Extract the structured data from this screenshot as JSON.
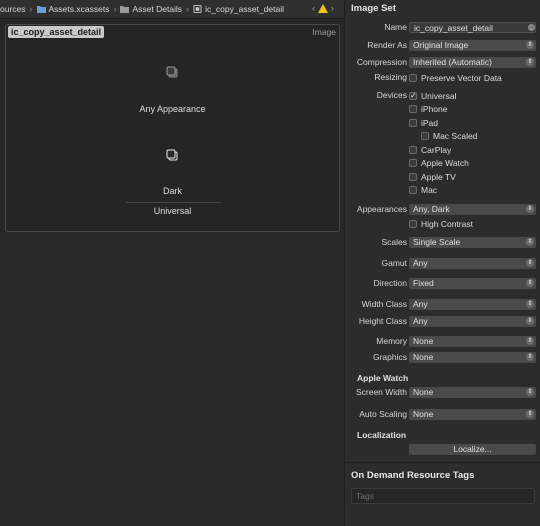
{
  "breadcrumb": {
    "items": [
      "ources",
      "Assets.xcassets",
      "Asset Details",
      "ic_copy_asset_detail"
    ]
  },
  "canvas": {
    "asset_name": "ic_copy_asset_detail",
    "asset_type": "Image",
    "slots": [
      {
        "label": "Any Appearance"
      },
      {
        "label": "Dark"
      }
    ],
    "group_label": "Universal"
  },
  "inspector": {
    "section_title": "Image Set",
    "name_label": "Name",
    "name_value": "ic_copy_asset_detail",
    "render_as_label": "Render As",
    "render_as_value": "Original Image",
    "compression_label": "Compression",
    "compression_value": "Inherited (Automatic)",
    "resizing_label": "Resizing",
    "preserve_vector_label": "Preserve Vector Data",
    "devices_label": "Devices",
    "devices": [
      {
        "label": "Universal",
        "checked": true
      },
      {
        "label": "iPhone",
        "checked": false
      },
      {
        "label": "iPad",
        "checked": false
      },
      {
        "label": "Mac Scaled",
        "checked": false
      },
      {
        "label": "CarPlay",
        "checked": false
      },
      {
        "label": "Apple Watch",
        "checked": false
      },
      {
        "label": "Apple TV",
        "checked": false
      },
      {
        "label": "Mac",
        "checked": false
      }
    ],
    "appearances_label": "Appearances",
    "appearances_value": "Any, Dark",
    "high_contrast_label": "High Contrast",
    "scales_label": "Scales",
    "scales_value": "Single Scale",
    "gamut_label": "Gamut",
    "gamut_value": "Any",
    "direction_label": "Direction",
    "direction_value": "Fixed",
    "width_class_label": "Width Class",
    "width_class_value": "Any",
    "height_class_label": "Height Class",
    "height_class_value": "Any",
    "memory_label": "Memory",
    "memory_value": "None",
    "graphics_label": "Graphics",
    "graphics_value": "None",
    "apple_watch_title": "Apple Watch",
    "screen_width_label": "Screen Width",
    "screen_width_value": "None",
    "auto_scaling_label": "Auto Scaling",
    "auto_scaling_value": "None",
    "localization_title": "Localization",
    "localize_button": "Localize...",
    "odr_title": "On Demand Resource Tags",
    "tags_placeholder": "Tags"
  },
  "colors": {
    "warning": "#f5c21b",
    "panel_bg": "#2c2c2c",
    "editor_bg": "#272727"
  }
}
